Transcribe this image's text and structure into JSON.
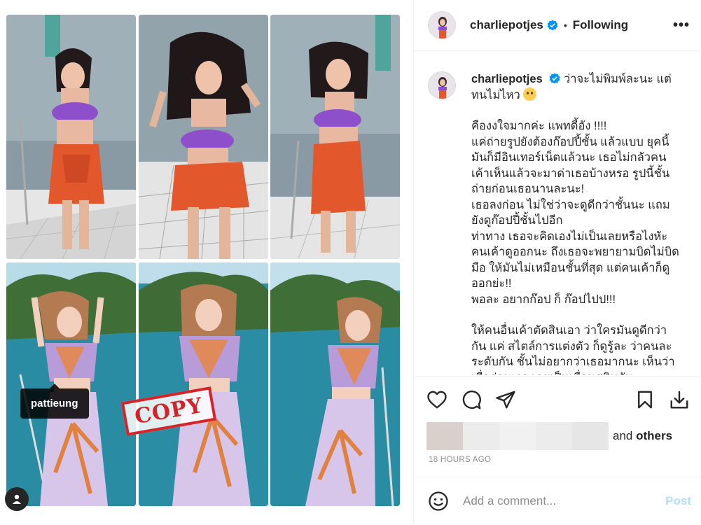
{
  "header": {
    "username": "charliepotjes",
    "separator": "•",
    "follow_status": "Following",
    "more_label": "•••"
  },
  "caption": {
    "username": "charliepotjes",
    "first_line": "ว่าจะไม่พิมพ์ละนะ แต่ทนไม่ไหว",
    "paragraph_1": "คืองงใจมากค่ะ แพทดี้อัง !!!!\nแค่ถ่ายรูปยังต้องก๊อปปี้ชั้น แล้วแบบ ยุคนี้มันก็มีอินเทอร์เน็ตแล้วนะ เธอไม่กลัวคนเค้าเห็นแล้วจะมาด่าเธอบ้างหรอ รูปนี้ชั้นถ่ายก่อนเธอนานละนะ!\nเธอลงก่อน ไม่ใช่ว่าจะดูดีกว่าชั้นนะ แถมยังดูก๊อปปี้ชั้นไปอีก",
    "paragraph_2": "ท่าทาง เธอจะคิดเองไม่เป็นเลยหรือไงหัะ คนเค้าดูออกนะ ถึงเธอจะพยายามบิดไม่บิดมือ ให้มันไม่เหมือนชั้นที่สุด แต่คนเค้าก็ดูออกย่ะ!!\nพอละ อยากก๊อป ก็ ก๊อปไปป!!!",
    "paragraph_3": "ให้คนอื่นเค้าตัดสินเอา ว่าใครมันดูดีกว่ากัน แค่ สไตล์การแต่งตัว ก็ดูรู้ละ ว่าคนละระดับกัน ชั้นไม่อยากว่าเธอมากนะ เห็นว่าเมื่อก่อนเรา เคยเป็นเพื่อนสนิทกัน"
  },
  "media": {
    "tag_label": "pattieung",
    "stamp_text": "COPY"
  },
  "likes": {
    "and_text": "and",
    "others_text": "others"
  },
  "timestamp": "18 HOURS AGO",
  "comment": {
    "placeholder": "Add a comment...",
    "post_label": "Post"
  },
  "colors": {
    "accent_blue": "#0095f6",
    "post_disabled": "#b2dffc",
    "muted": "#8e8e8e"
  },
  "icons": [
    "heart-icon",
    "comment-icon",
    "share-icon",
    "bookmark-icon",
    "download-icon",
    "emoji-icon",
    "user-tag-icon",
    "verified-icon",
    "more-icon"
  ]
}
